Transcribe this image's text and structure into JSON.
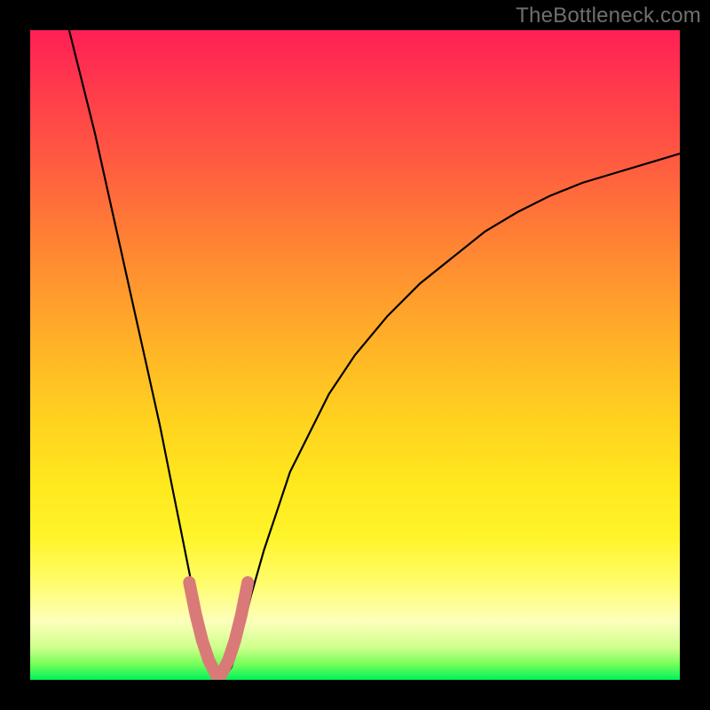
{
  "watermark": "TheBottleneck.com",
  "colors": {
    "curve": "#000000",
    "highlight": "#d97a78",
    "frame": "#000000",
    "watermark": "#6f6f6f",
    "gradient_stops": [
      "#ff1f55",
      "#ff3d4a",
      "#ff5a41",
      "#ff7a36",
      "#ff992e",
      "#ffb726",
      "#ffd21f",
      "#ffe81e",
      "#fff42a",
      "#fffd6b",
      "#fcffbb",
      "#d0ff8c",
      "#7aff5b",
      "#00f25a"
    ]
  },
  "chart_data": {
    "type": "line",
    "title": "",
    "xlabel": "",
    "ylabel": "",
    "xlim": [
      0,
      100
    ],
    "ylim": [
      0,
      100
    ],
    "grid": false,
    "legend": false,
    "note": "V-shaped bottleneck curve. Values are percentage-of-plot-area coordinates read from the figure; y is plotted top-to-bottom (0 at top).",
    "series": [
      {
        "name": "bottleneck-curve",
        "color": "#000000",
        "x": [
          6,
          8,
          10,
          12,
          14,
          16,
          18,
          20,
          22,
          23,
          24,
          25,
          26,
          27,
          28,
          29,
          30,
          31,
          32,
          33,
          34,
          36,
          38,
          40,
          43,
          46,
          50,
          55,
          60,
          65,
          70,
          75,
          80,
          85,
          90,
          95,
          100
        ],
        "y": [
          0,
          8,
          16,
          25,
          34,
          43,
          52,
          61,
          71,
          76,
          81,
          86,
          91,
          95,
          98,
          99.5,
          99.5,
          98,
          95,
          91,
          87,
          80,
          74,
          68,
          62,
          56,
          50,
          44,
          39,
          35,
          31,
          28,
          25.5,
          23.5,
          22,
          20.5,
          19
        ]
      }
    ],
    "highlight": {
      "name": "sweet-spot",
      "color": "#d97a78",
      "x": [
        24.5,
        25.5,
        26.5,
        27.5,
        28.5,
        29.5,
        30.5,
        31.5,
        32.5,
        33.5
      ],
      "y": [
        85,
        90,
        94,
        97,
        99,
        99,
        97,
        94,
        90,
        85
      ]
    }
  }
}
